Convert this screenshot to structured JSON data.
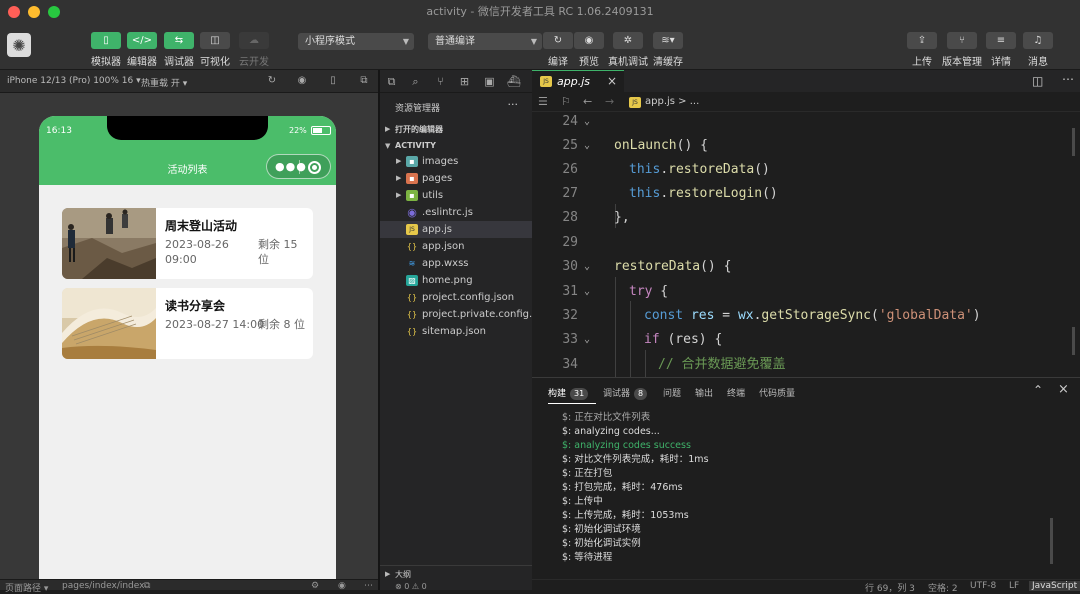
{
  "window": {
    "title": "activity - 微信开发者工具 RC 1.06.2409131"
  },
  "colors": {
    "accent": "#3fb36a",
    "phone_nav": "#4bbd6a"
  },
  "toolbar": {
    "simulator": "模拟器",
    "editor": "编辑器",
    "debugger": "调试器",
    "visual": "可视化",
    "cloud": "云开发",
    "mode_select": "小程序模式",
    "compile_select": "普通编译",
    "compile": "编译",
    "preview": "预览",
    "device_debug": "真机调试",
    "clear_cache": "清缓存",
    "upload": "上传",
    "version": "版本管理",
    "details": "详情",
    "messages": "消息"
  },
  "simulator": {
    "device": "iPhone 12/13 (Pro) 100% 16 ▾",
    "hot_reload": "热重载 开 ▾",
    "status_time": "16:13",
    "battery": "22%",
    "page_title": "活动列表",
    "capsule_dots": "●●●",
    "activities": [
      {
        "title": "周末登山活动",
        "date": "2023-08-26",
        "time": "09:00",
        "remain": "剩余 15",
        "remain_unit": "位"
      },
      {
        "title": "读书分享会",
        "datetime": "2023-08-27 14:00",
        "remain": "剩余 8 位"
      }
    ],
    "page_path_label": "页面路径 ▾",
    "page_path": "pages/index/index"
  },
  "explorer": {
    "title": "资源管理器",
    "more": "···",
    "open_editors": "打开的编辑器",
    "project": "ACTIVITY",
    "files": [
      {
        "name": "images",
        "icon": "folder-images"
      },
      {
        "name": "pages",
        "icon": "folder-pages"
      },
      {
        "name": "utils",
        "icon": "folder-utils"
      },
      {
        "name": ".eslintrc.js",
        "icon": "eslint"
      },
      {
        "name": "app.js",
        "icon": "js"
      },
      {
        "name": "app.json",
        "icon": "json"
      },
      {
        "name": "app.wxss",
        "icon": "wxss"
      },
      {
        "name": "home.png",
        "icon": "image"
      },
      {
        "name": "project.config.json",
        "icon": "json"
      },
      {
        "name": "project.private.config...",
        "icon": "json"
      },
      {
        "name": "sitemap.json",
        "icon": "json"
      }
    ],
    "outline": "大纲",
    "problems": "⊗ 0 ⚠ 0"
  },
  "editor": {
    "tab": "app.js",
    "breadcrumb": "app.js > ...",
    "lines": [
      {
        "n": "24"
      },
      {
        "n": "25"
      },
      {
        "n": "26"
      },
      {
        "n": "27"
      },
      {
        "n": "28"
      },
      {
        "n": "29"
      },
      {
        "n": "30"
      },
      {
        "n": "31"
      },
      {
        "n": "32"
      },
      {
        "n": "33"
      },
      {
        "n": "34"
      }
    ],
    "code": {
      "l25a": "onLaunch",
      "l25b": "() {",
      "l26a": "this",
      "l26b": ".",
      "l26c": "restoreData",
      "l26d": "()",
      "l27a": "this",
      "l27b": ".",
      "l27c": "restoreLogin",
      "l27d": "()",
      "l28": "},",
      "l30a": "restoreData",
      "l30b": "() {",
      "l31a": "try",
      "l31b": " {",
      "l32a": "const",
      "l32b": " res ",
      "l32c": "= ",
      "l32d": "wx",
      "l32e": ".",
      "l32f": "getStorageSync",
      "l32g": "(",
      "l32h": "'globalData'",
      "l32i": ")",
      "l33a": "if",
      "l33b": " (res) {",
      "l34": "// 合并数据避免覆盖"
    }
  },
  "panel": {
    "tabs": [
      {
        "label": "构建",
        "badge": "31"
      },
      {
        "label": "调试器",
        "badge": "8"
      },
      {
        "label": "问题"
      },
      {
        "label": "输出"
      },
      {
        "label": "终端"
      },
      {
        "label": "代码质量"
      }
    ],
    "output": [
      "$: 正在对比文件列表",
      "$: analyzing codes...",
      "$: analyzing codes success",
      "$: 对比文件列表完成，耗时：1ms",
      "$: 正在打包",
      "$: 打包完成，耗时：476ms",
      "$: 上传中",
      "$: 上传完成，耗时：1053ms",
      "$: 初始化调试环境",
      "$: 初始化调试实例",
      "$: 等待进程"
    ]
  },
  "statusbar": {
    "position": "行 69，列 3",
    "spaces": "空格: 2",
    "encoding": "UTF-8",
    "eol": "LF",
    "language": "JavaScript"
  }
}
